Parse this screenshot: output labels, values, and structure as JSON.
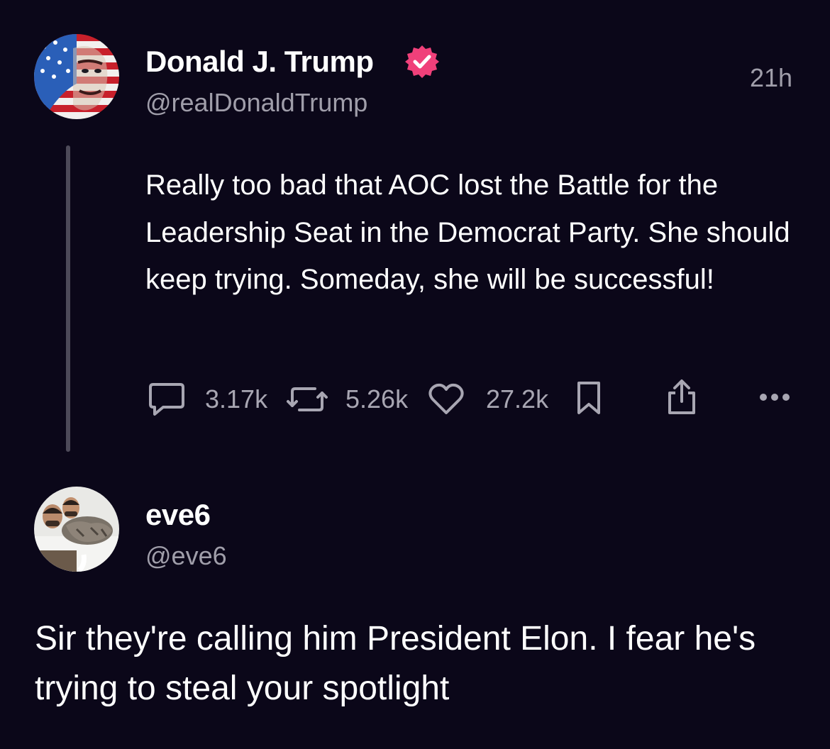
{
  "posts": [
    {
      "author": {
        "display_name": "Donald J. Trump",
        "handle": "@realDonaldTrump",
        "verified": true,
        "avatar": "flag-portrait-avatar"
      },
      "time": "21h",
      "text": "Really too bad that AOC lost the Battle for the Leadership Seat in the Democrat Party. She should keep trying. Someday, she will be successful!",
      "actions": {
        "replies": "3.17k",
        "reposts": "5.26k",
        "likes": "27.2k"
      }
    },
    {
      "author": {
        "display_name": "eve6",
        "handle": "@eve6",
        "avatar": "two-men-with-cat-avatar"
      },
      "text": "Sir they're calling him President Elon. I fear he's trying to steal your spotlight"
    }
  ],
  "icons": {
    "reply": "speech-bubble-icon",
    "repost": "repost-arrows-icon",
    "like": "heart-icon",
    "bookmark": "bookmark-icon",
    "share": "share-icon",
    "more": "more-dots-icon"
  },
  "colors": {
    "background": "#0b0719",
    "text": "#ffffff",
    "secondary_text": "#a09eaa",
    "verified_badge": "#f0407a",
    "thread_line": "#4d4a59"
  }
}
